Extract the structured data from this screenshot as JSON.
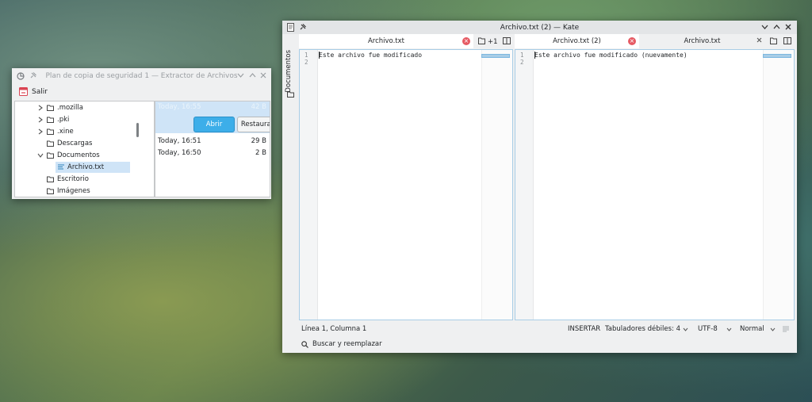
{
  "backup_window": {
    "title": "Plan de copia de seguridad 1 — Extractor de Archivos",
    "quit_label": "Salir",
    "tree": [
      {
        "label": ".mozilla",
        "expander": "chevron-right",
        "depth": 1,
        "selected": false
      },
      {
        "label": ".pki",
        "expander": "chevron-right",
        "depth": 1,
        "selected": false
      },
      {
        "label": ".xine",
        "expander": "chevron-right",
        "depth": 1,
        "selected": false
      },
      {
        "label": "Descargas",
        "expander": "none",
        "depth": 1,
        "selected": false
      },
      {
        "label": "Documentos",
        "expander": "chevron-down",
        "depth": 1,
        "selected": false
      },
      {
        "label": "Archivo.txt",
        "expander": "none",
        "depth": 2,
        "selected": true,
        "icon": "text-file-icon"
      },
      {
        "label": "Escritorio",
        "expander": "none",
        "depth": 1,
        "selected": false
      },
      {
        "label": "Imágenes",
        "expander": "none",
        "depth": 1,
        "selected": false
      }
    ],
    "versions": [
      {
        "time": "Today, 16:55",
        "size": "42 B",
        "selected": true
      },
      {
        "time": "Today, 16:51",
        "size": "29 B",
        "selected": false
      },
      {
        "time": "Today, 16:50",
        "size": "2 B",
        "selected": false
      }
    ],
    "open_label": "Abrir",
    "restore_label": "Restaurar"
  },
  "kate_window": {
    "title": "Archivo.txt (2) — Kate",
    "sidebar_label": "Documentos",
    "left_tabs": [
      {
        "label": "Archivo.txt",
        "active": true
      }
    ],
    "left_extra": "+1",
    "right_tabs": [
      {
        "label": "Archivo.txt (2)",
        "active": true
      },
      {
        "label": "Archivo.txt",
        "active": false
      }
    ],
    "left_pane": {
      "line_numbers": [
        "1",
        "2"
      ],
      "lines": [
        "Este archivo fue modificado",
        ""
      ]
    },
    "right_pane": {
      "line_numbers": [
        "1",
        "2"
      ],
      "lines": [
        "Este archivo fue modificado (nuevamente)",
        ""
      ]
    },
    "status": {
      "position": "Línea 1, Columna 1",
      "mode": "INSERTAR",
      "indent": "Tabuladores débiles: 4",
      "encoding": "UTF-8",
      "highlight": "Normal"
    },
    "find_label": "Buscar y reemplazar"
  },
  "colors": {
    "accent": "#3daee9",
    "selection": "#cfe4f7",
    "close": "#e65a63"
  }
}
